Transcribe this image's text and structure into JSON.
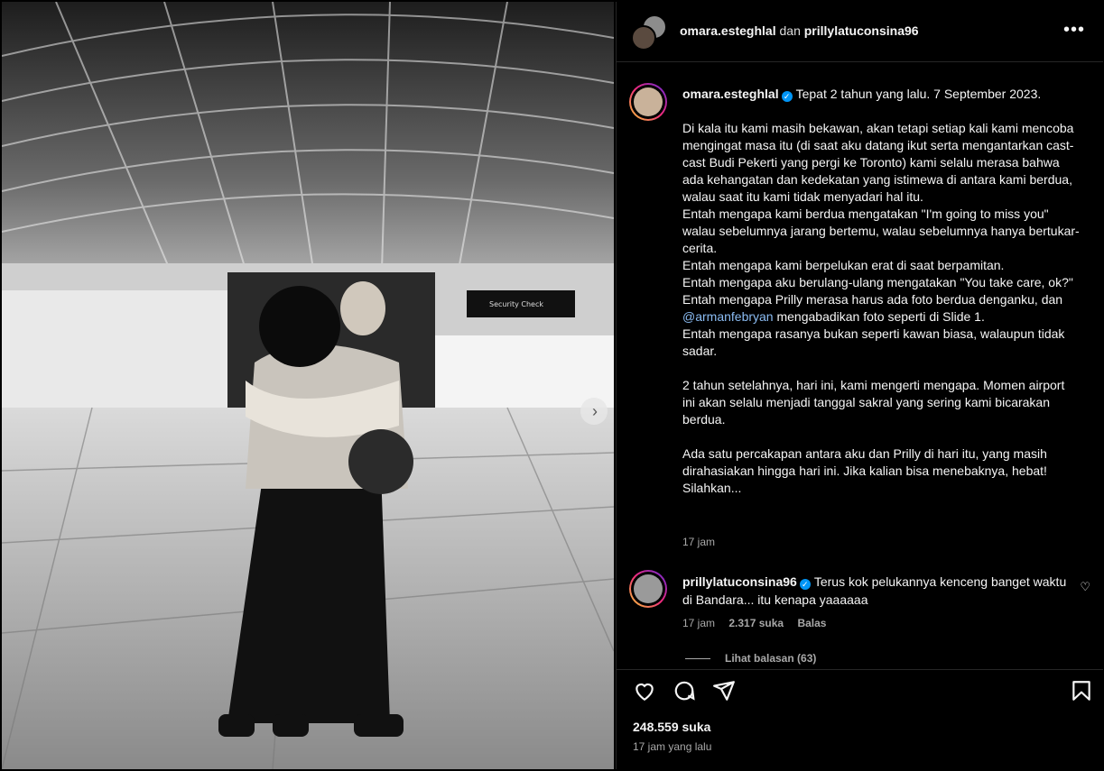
{
  "header": {
    "user1": "omara.esteghlal",
    "joiner": "dan",
    "user2": "prillylatuconsina96",
    "more_icon": "more-horizontal-icon"
  },
  "caption": {
    "username": "omara.esteghlal",
    "first_line": "Tepat 2 tahun yang lalu. 7 September 2023.",
    "para1": "Di kala itu kami masih bekawan, akan tetapi setiap kali kami mencoba mengingat masa itu (di saat aku datang ikut serta mengantarkan cast-cast Budi Pekerti yang pergi ke Toronto) kami selalu merasa bahwa ada kehangatan dan kedekatan yang istimewa di antara kami berdua, walau saat itu kami tidak menyadari hal itu.",
    "line2": "Entah mengapa kami berdua mengatakan \"I'm going to miss you\" walau sebelumnya jarang bertemu, walau sebelumnya hanya bertukar-cerita.",
    "line3": "Entah mengapa kami berpelukan erat di saat berpamitan.",
    "line4": "Entah mengapa aku berulang-ulang mengatakan \"You take care, ok?\"",
    "line5": "Entah mengapa Prilly merasa harus ada foto berdua denganku, dan",
    "mention": "@armanfebryan",
    "line5b": "mengabadikan foto seperti di Slide 1.",
    "line6": "Entah mengapa rasanya bukan seperti kawan biasa, walaupun tidak sadar.",
    "para2": "2 tahun setelahnya, hari ini, kami mengerti mengapa. Momen airport ini akan selalu menjadi tanggal sakral yang sering kami bicarakan berdua.",
    "para3": "Ada satu percakapan antara aku dan Prilly di hari itu, yang masih dirahasiakan hingga hari ini. Jika kalian bisa menebaknya, hebat! Silahkan...",
    "time": "17 jam"
  },
  "comment": {
    "username": "prillylatuconsina96",
    "text": "Terus kok pelukannya kenceng banget waktu di Bandara... itu kenapa yaaaaaa",
    "time": "17 jam",
    "likes": "2.317 suka",
    "reply": "Balas",
    "view_replies": "Lihat balasan (63)"
  },
  "footer": {
    "likes": "248.559 suka",
    "ago": "17 jam yang lalu"
  }
}
